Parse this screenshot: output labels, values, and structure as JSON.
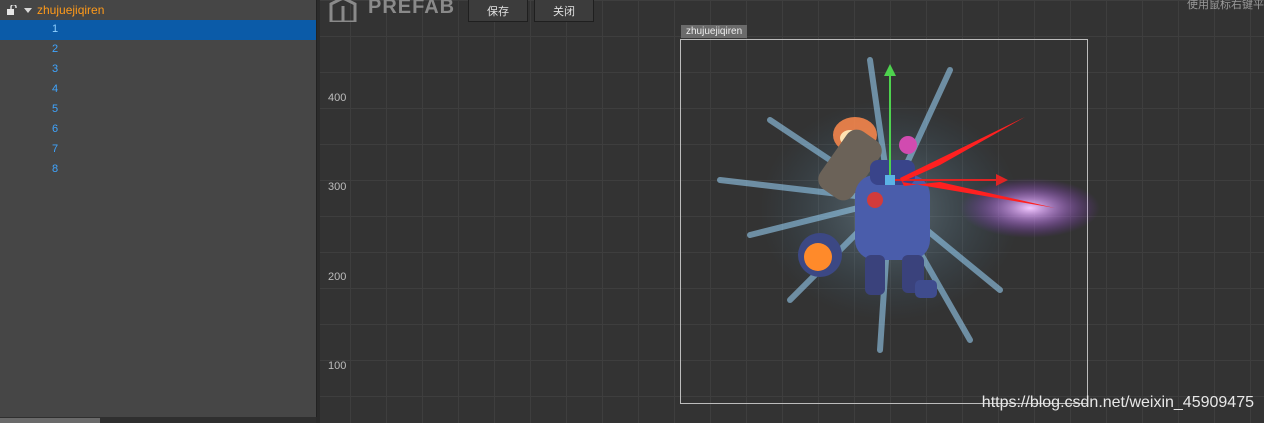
{
  "hierarchy": {
    "root_label": "zhujuejiqiren",
    "items": [
      "1",
      "2",
      "3",
      "4",
      "5",
      "6",
      "7",
      "8"
    ],
    "selected_index": 0
  },
  "toolbar": {
    "logo_text": "PREFAB",
    "save_label": "保存",
    "close_label": "关闭",
    "hint_text": "使用鼠标右键平"
  },
  "scene": {
    "axis_labels": [
      "400",
      "300",
      "200",
      "100"
    ],
    "node_name": "zhujuejiqiren",
    "watermark": "https://blog.csdn.net/weixin_45909475"
  }
}
